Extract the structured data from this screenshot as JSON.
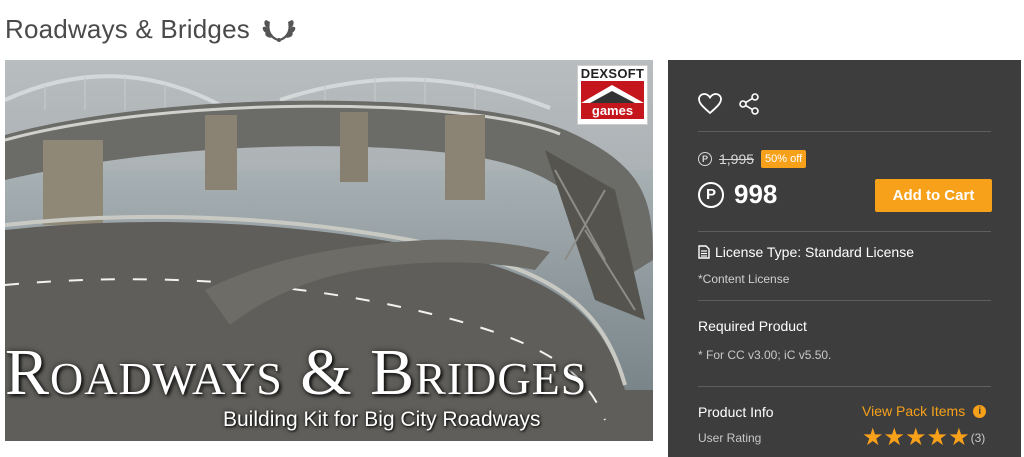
{
  "page": {
    "title": "Roadways & Bridges",
    "badge_icon": "laurel-award-icon"
  },
  "hero": {
    "title": "Roadways & Bridges",
    "subtitle": "Building Kit for Big City Roadways",
    "brand_top": "DEXSOFT",
    "brand_bottom": "games"
  },
  "panel": {
    "icons": [
      "heart-icon",
      "share-icon"
    ],
    "price": {
      "original": "1,995",
      "discount": "50% off",
      "current": "998",
      "currency_symbol": "P"
    },
    "cart_label": "Add to Cart",
    "license": {
      "title": "License Type: Standard License",
      "sub": "*Content License"
    },
    "required": {
      "title": "Required Product",
      "note": "* For CC v3.00; iC v5.50."
    },
    "info": {
      "title": "Product Info",
      "link": "View Pack Items",
      "rating_label": "User Rating",
      "rating_stars": 5,
      "rating_count": "(3)"
    },
    "accent_color": "#f7a11a"
  }
}
